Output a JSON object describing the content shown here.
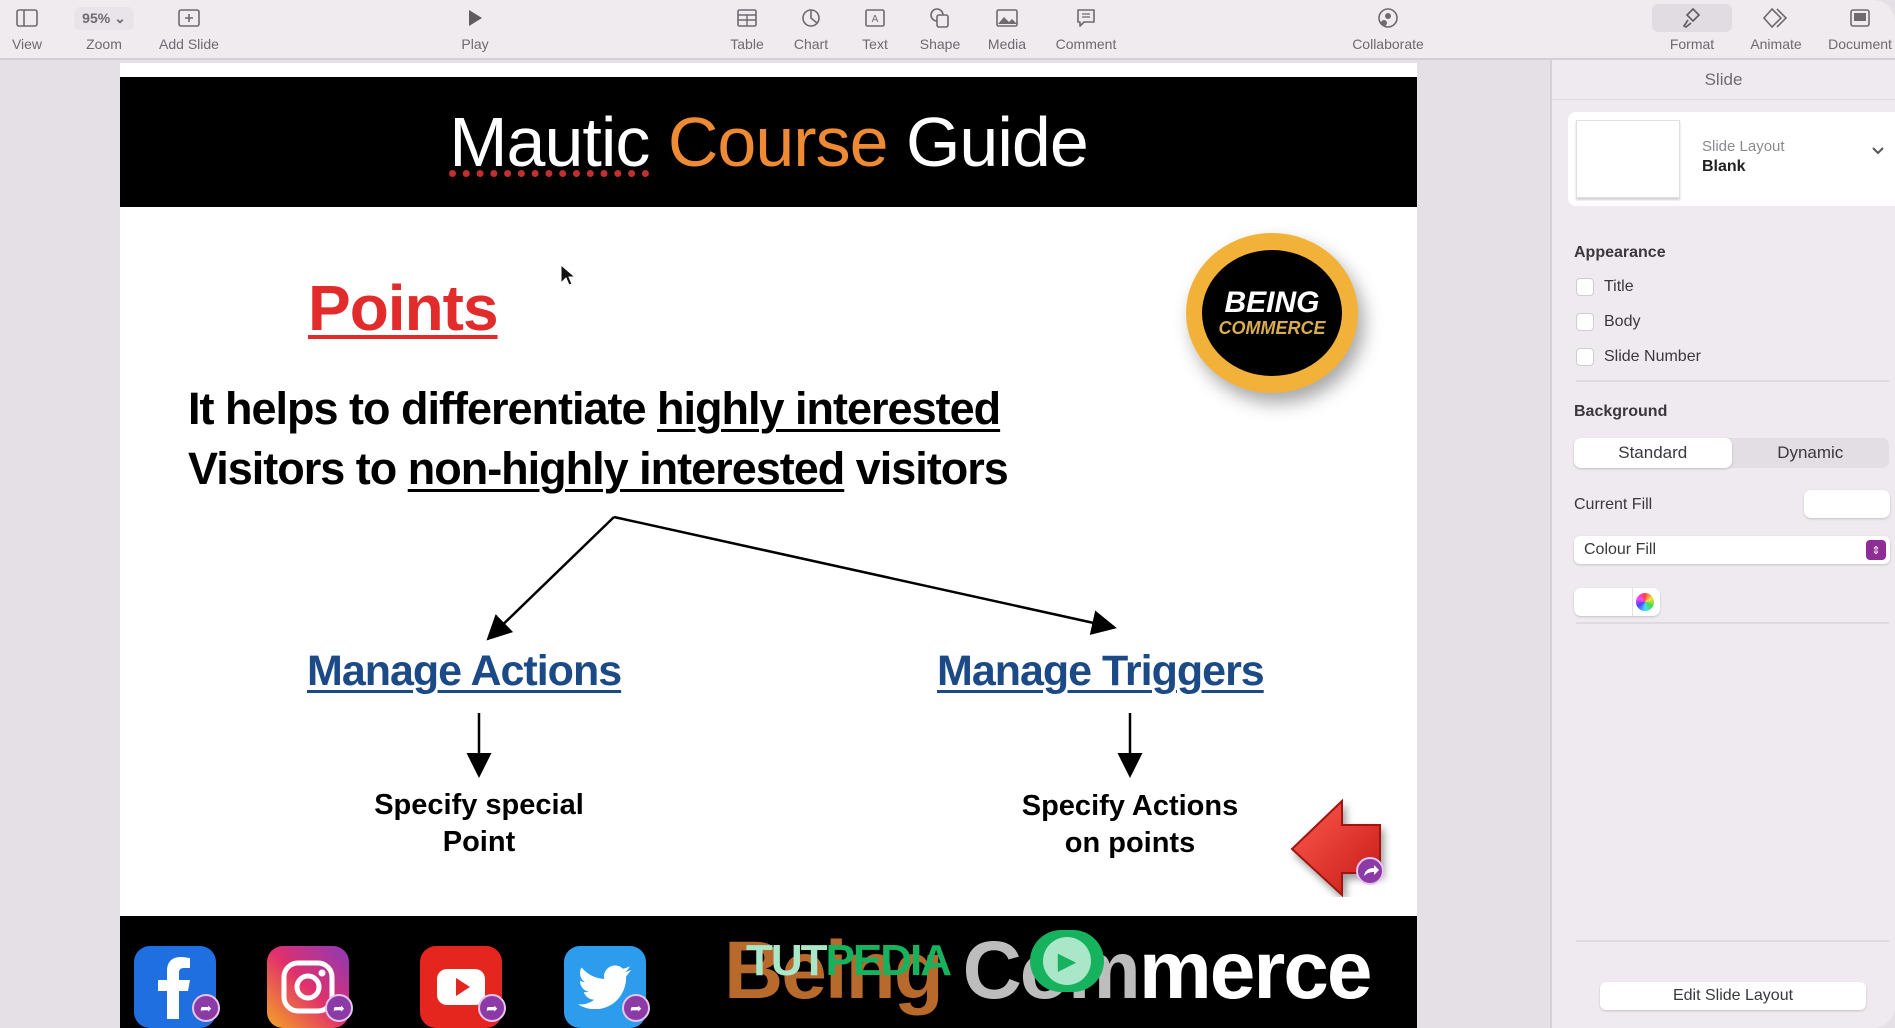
{
  "toolbar": {
    "view": "View",
    "zoom": "Zoom",
    "zoom_value": "95%",
    "add_slide": "Add Slide",
    "play": "Play",
    "table": "Table",
    "chart": "Chart",
    "text": "Text",
    "shape": "Shape",
    "media": "Media",
    "comment": "Comment",
    "collaborate": "Collaborate",
    "format": "Format",
    "animate": "Animate",
    "document": "Document"
  },
  "slide": {
    "title_part1": "Mautic",
    "title_part2": "Course",
    "title_part3": "Guide",
    "accent_color": "#ee8a34",
    "heading": "Points",
    "desc_line1_a": "It helps to differentiate ",
    "desc_line1_u": "highly interested",
    "desc_line2_a": "Visitors to ",
    "desc_line2_u": "non-highly interested",
    "desc_line2_b": " visitors",
    "branch_left": "Manage Actions",
    "branch_right": "Manage Triggers",
    "spec_left_1": "Specify special",
    "spec_left_2": "Point",
    "spec_right_1": "Specify Actions",
    "spec_right_2": "on points",
    "logo_line1": "BEING",
    "logo_line2": "COMMERCE",
    "footer_brand_1": "Being",
    "footer_brand_2": "Com",
    "footer_brand_3": "merce",
    "watermark_1": "TUT",
    "watermark_2": "PEDIA"
  },
  "sidebar": {
    "tab": "Slide",
    "layout_label": "Slide Layout",
    "layout_value": "Blank",
    "appearance_heading": "Appearance",
    "appearance_items": [
      {
        "label": "Title",
        "checked": false
      },
      {
        "label": "Body",
        "checked": false
      },
      {
        "label": "Slide Number",
        "checked": false
      }
    ],
    "background_heading": "Background",
    "background_options": [
      "Standard",
      "Dynamic"
    ],
    "background_selected": "Standard",
    "current_fill_label": "Current Fill",
    "fill_type": "Colour Fill",
    "edit_layout_button": "Edit Slide Layout"
  }
}
